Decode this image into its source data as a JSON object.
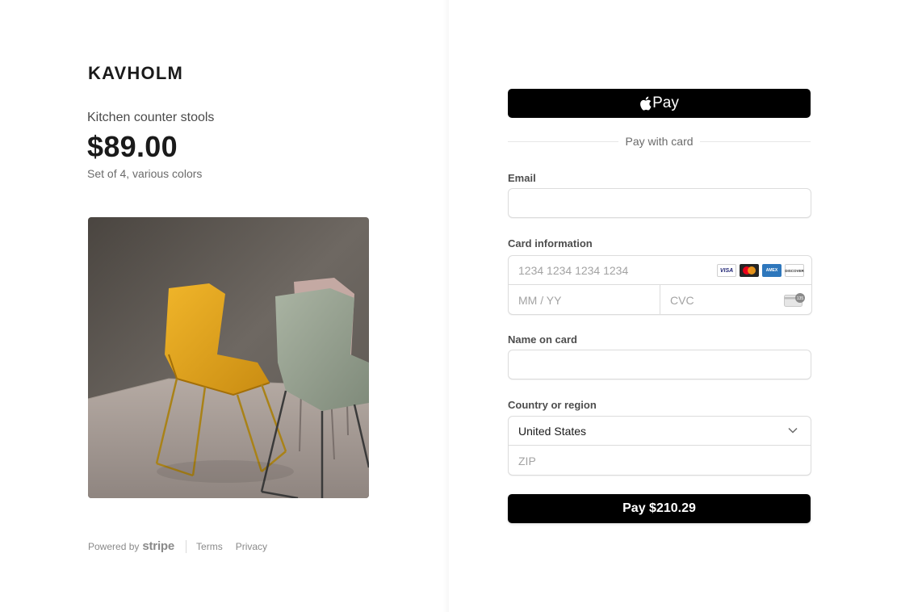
{
  "merchant": {
    "name": "KAVHOLM"
  },
  "product": {
    "name": "Kitchen counter stools",
    "price": "$89.00",
    "description": "Set of 4, various colors",
    "image_icon": "chairs-photo"
  },
  "footer": {
    "powered_by": "Powered by",
    "stripe": "stripe",
    "terms": "Terms",
    "privacy": "Privacy"
  },
  "apple_pay": {
    "label": "Pay",
    "icon": "apple-icon"
  },
  "divider_text": "Pay with card",
  "form": {
    "email_label": "Email",
    "email_value": "",
    "card_label": "Card information",
    "card_number_placeholder": "1234 1234 1234 1234",
    "card_brands": [
      "VISA",
      "Mastercard",
      "AMEX",
      "DISCOVER"
    ],
    "expiry_placeholder": "MM / YY",
    "cvc_placeholder": "CVC",
    "cvc_icon_text": "135",
    "name_label": "Name on card",
    "name_value": "",
    "country_label": "Country or region",
    "country_value": "United States",
    "zip_placeholder": "ZIP"
  },
  "pay_button": {
    "label": "Pay $210.29"
  },
  "colors": {
    "button_bg": "#000000",
    "text": "#1a1a1a",
    "muted": "#6b6b6b"
  }
}
